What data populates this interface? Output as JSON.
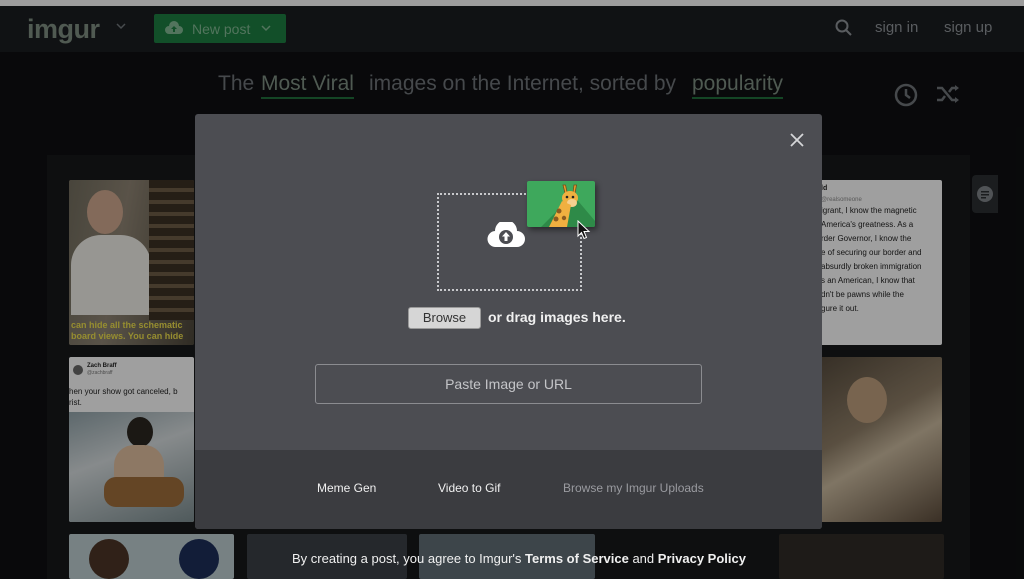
{
  "header": {
    "logo": "imgur",
    "new_post": "New post",
    "sign_in": "sign in",
    "sign_up": "sign up"
  },
  "headline": {
    "part1": "The",
    "sort1": "Most Viral",
    "part2": "images on the Internet, sorted by",
    "sort2": "popularity"
  },
  "gallery": {
    "tile1_caption_line1": "can hide all the schematic",
    "tile1_caption_line2": "board views. You can hide",
    "tile2_name": "Zach Braff",
    "tile2_handle": "@zachbraff",
    "tile2_text_line1": "hen your show got canceled, b",
    "tile2_text_line2": "rist.",
    "tile3_lines": [
      "ld",
      "@realsomeone",
      "igrant, I know the magnetic",
      "America's greatness. As a",
      "rder Governor, I know the",
      "e of securing our border and",
      "absurdly broken immigration",
      "s an American, I know that",
      "dn't be pawns while the",
      "gure it out."
    ]
  },
  "modal": {
    "browse": "Browse",
    "drag_text": "or drag images here.",
    "paste_placeholder": "Paste Image or URL",
    "footer": {
      "meme_gen": "Meme Gen",
      "video_to_gif": "Video to Gif",
      "browse_uploads": "Browse my Imgur Uploads"
    }
  },
  "terms": {
    "prefix": "By creating a post, you agree to Imgur's",
    "tos": "Terms of Service",
    "and": "and",
    "privacy": "Privacy Policy"
  },
  "colors": {
    "accent_green": "#1c7a3f",
    "modal_bg": "#4c4d52",
    "modal_footer_bg": "#3b3c40"
  }
}
